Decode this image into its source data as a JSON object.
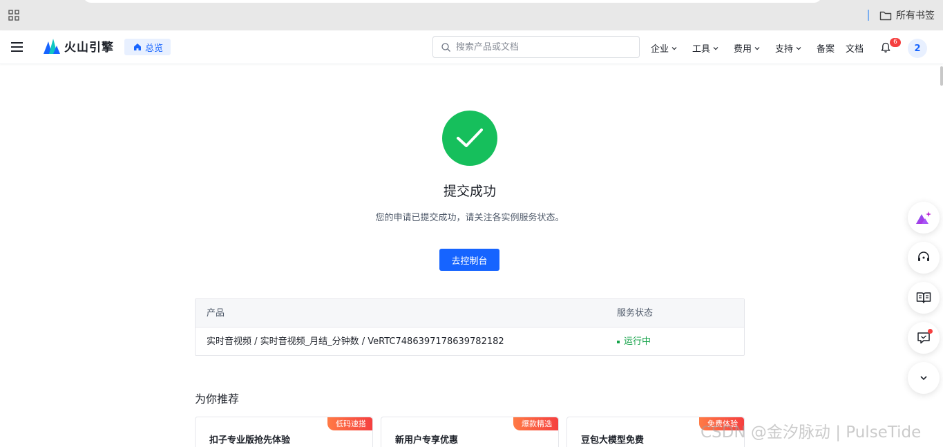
{
  "browser": {
    "all_bookmarks": "所有书签"
  },
  "header": {
    "logo_text": "火山引擎",
    "overview_label": "总览",
    "search_placeholder": "搜索产品或文档",
    "nav": {
      "enterprise": "企业",
      "tools": "工具",
      "billing": "费用",
      "support": "支持",
      "filing": "备案",
      "docs": "文档"
    },
    "notification_count": "6",
    "avatar_text": "2"
  },
  "result": {
    "title": "提交成功",
    "description": "您的申请已提交成功，请关注各实例服务状态。",
    "console_button": "去控制台"
  },
  "table": {
    "headers": [
      "产品",
      "服务状态"
    ],
    "rows": [
      {
        "product": "实时音视频 / 实时音视频_月结_分钟数 / VeRTC7486397178639782182",
        "status": "运行中"
      }
    ]
  },
  "recommend": {
    "title": "为你推荐",
    "cards": [
      {
        "title": "扣子专业版抢先体验",
        "tag": "低码速搭"
      },
      {
        "title": "新用户专享优惠",
        "tag": "爆款精选"
      },
      {
        "title": "豆包大模型免费",
        "tag": "免费体验"
      }
    ]
  },
  "watermark": "CSDN @金汐脉动 | PulseTide",
  "colors": {
    "primary": "#1664ff",
    "success": "#16bf5c",
    "status_running": "#16a34a",
    "badge": "#f53f3f"
  },
  "icons": {
    "apps": "apps-grid-icon",
    "folder": "folder-icon",
    "menu": "hamburger-menu-icon",
    "home": "home-icon",
    "search": "search-icon",
    "chevron": "chevron-down-icon",
    "bell": "bell-icon",
    "check": "check-icon",
    "side": [
      "ai-assistant-icon",
      "customer-service-icon",
      "book-icon",
      "feedback-icon",
      "chevron-down-icon"
    ]
  }
}
